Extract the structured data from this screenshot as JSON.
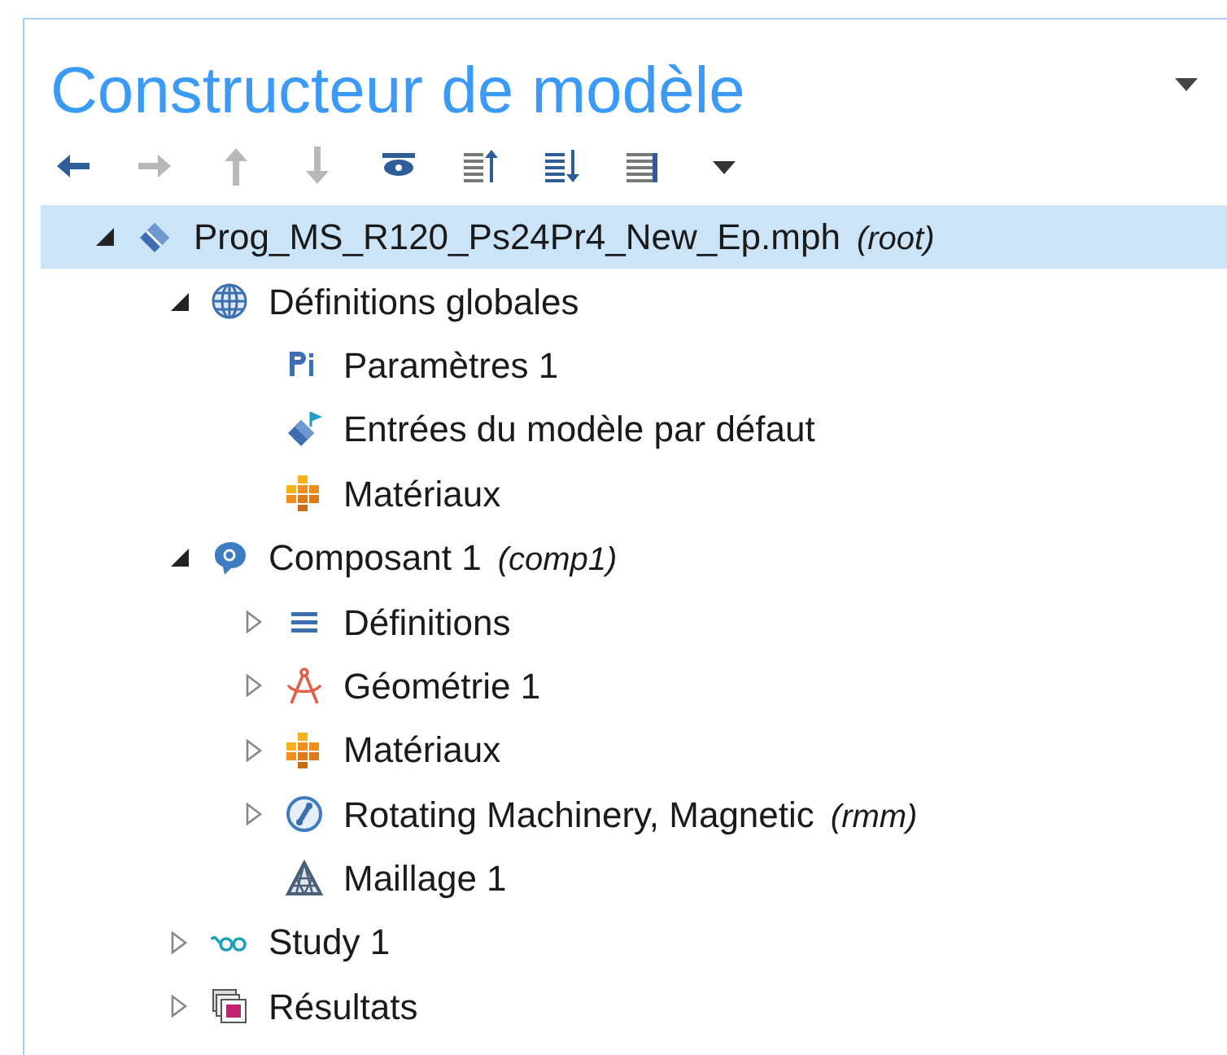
{
  "panel": {
    "title": "Constructeur de modèle"
  },
  "toolbar": [
    {
      "kind": "back",
      "disabled": false
    },
    {
      "kind": "forward",
      "disabled": true
    },
    {
      "kind": "up",
      "disabled": true
    },
    {
      "kind": "down",
      "disabled": true
    },
    {
      "kind": "show",
      "disabled": false
    },
    {
      "kind": "collapse",
      "disabled": false
    },
    {
      "kind": "expand",
      "disabled": false
    },
    {
      "kind": "list",
      "disabled": false
    },
    {
      "kind": "menu",
      "disabled": false
    }
  ],
  "tree": [
    {
      "kind": "file",
      "label": "Prog_MS_R120_Ps24Pr4_New_Ep.mph",
      "tag": "(root)",
      "selected": true,
      "expanded": true,
      "children": [
        {
          "kind": "globe",
          "label": "Définitions globales",
          "selected": false,
          "expanded": true,
          "children": [
            {
              "kind": "parameters",
              "label": "Paramètres 1",
              "selected": false
            },
            {
              "kind": "model-inputs",
              "label": "Entrées du modèle par défaut",
              "selected": false
            },
            {
              "kind": "materials",
              "label": "Matériaux",
              "selected": false
            }
          ]
        },
        {
          "kind": "component",
          "label": "Composant 1",
          "tag": "(comp1)",
          "selected": false,
          "expanded": true,
          "children": [
            {
              "kind": "definitions",
              "label": "Définitions",
              "selected": false,
              "expanded": false
            },
            {
              "kind": "geometry",
              "label": "Géométrie 1",
              "selected": false,
              "expanded": false
            },
            {
              "kind": "materials",
              "label": "Matériaux",
              "selected": false,
              "expanded": false
            },
            {
              "kind": "physics",
              "label": "Rotating Machinery, Magnetic",
              "tag": "(rmm)",
              "selected": false,
              "expanded": false
            },
            {
              "kind": "mesh",
              "label": "Maillage 1",
              "selected": false
            }
          ]
        },
        {
          "kind": "study",
          "label": "Study 1",
          "selected": false,
          "expanded": false
        },
        {
          "kind": "results",
          "label": "Résultats",
          "selected": false,
          "expanded": false
        }
      ]
    }
  ]
}
